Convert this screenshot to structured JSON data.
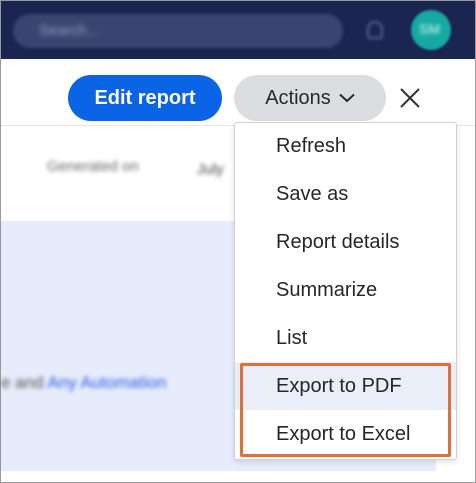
{
  "topbar": {
    "search_placeholder": "Search...",
    "avatar_initials": "SM"
  },
  "toolbar": {
    "edit_report_label": "Edit report",
    "actions_label": "Actions"
  },
  "content": {
    "generated_label": "Generated on",
    "generated_value": "July",
    "panel_text_prefix": "e and ",
    "panel_link_text": "Any Automation"
  },
  "actions_menu": {
    "items": [
      {
        "label": "Refresh"
      },
      {
        "label": "Save as"
      },
      {
        "label": "Report details"
      },
      {
        "label": "Summarize"
      },
      {
        "label": "List"
      },
      {
        "label": "Export to PDF"
      },
      {
        "label": "Export to Excel"
      }
    ],
    "hovered_item": "Export to PDF",
    "highlight_color": "#e0703a"
  },
  "colors": {
    "nav_bg": "#1b2552",
    "primary": "#0b63e5",
    "avatar": "#15a9a1",
    "panel_bg": "#e6ecfb"
  }
}
